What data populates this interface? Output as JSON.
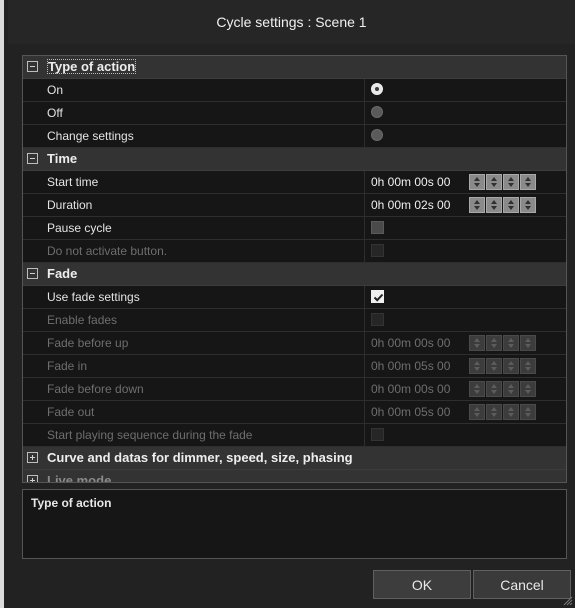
{
  "window": {
    "title": "Cycle settings : Scene 1"
  },
  "sections": {
    "type_of_action": {
      "label": "Type of action"
    },
    "time": {
      "label": "Time"
    },
    "fade": {
      "label": "Fade"
    },
    "curve": {
      "label": "Curve and datas for dimmer, speed, size, phasing"
    },
    "live_mode": {
      "label": "Live mode"
    }
  },
  "type_of_action": {
    "on": {
      "label": "On",
      "selected": true
    },
    "off": {
      "label": "Off",
      "selected": false
    },
    "change_settings": {
      "label": "Change settings",
      "selected": false
    }
  },
  "time": {
    "start_time": {
      "label": "Start time",
      "value": "0h 00m 00s 00"
    },
    "duration": {
      "label": "Duration",
      "value": "0h 00m 02s 00"
    },
    "pause_cycle": {
      "label": "Pause cycle",
      "checked": false
    },
    "do_not_activate": {
      "label": "Do not activate button.",
      "checked": false,
      "enabled": false
    }
  },
  "fade": {
    "use_fade_settings": {
      "label": "Use fade settings",
      "checked": true
    },
    "enable_fades": {
      "label": "Enable fades",
      "checked": false,
      "enabled": false
    },
    "fade_before_up": {
      "label": "Fade before up",
      "value": "0h 00m 00s 00"
    },
    "fade_in": {
      "label": "Fade in",
      "value": "0h 00m 05s 00"
    },
    "fade_before_down": {
      "label": "Fade before down",
      "value": "0h 00m 00s 00"
    },
    "fade_out": {
      "label": "Fade out",
      "value": "0h 00m 05s 00"
    },
    "start_playing": {
      "label": "Start playing sequence during the fade",
      "checked": false
    }
  },
  "description": {
    "title": "Type of action"
  },
  "buttons": {
    "ok": "OK",
    "cancel": "Cancel"
  },
  "colors": {
    "background": "#222222",
    "panel": "#161616",
    "section": "#333333",
    "disabled_text": "#6e6e6e"
  }
}
